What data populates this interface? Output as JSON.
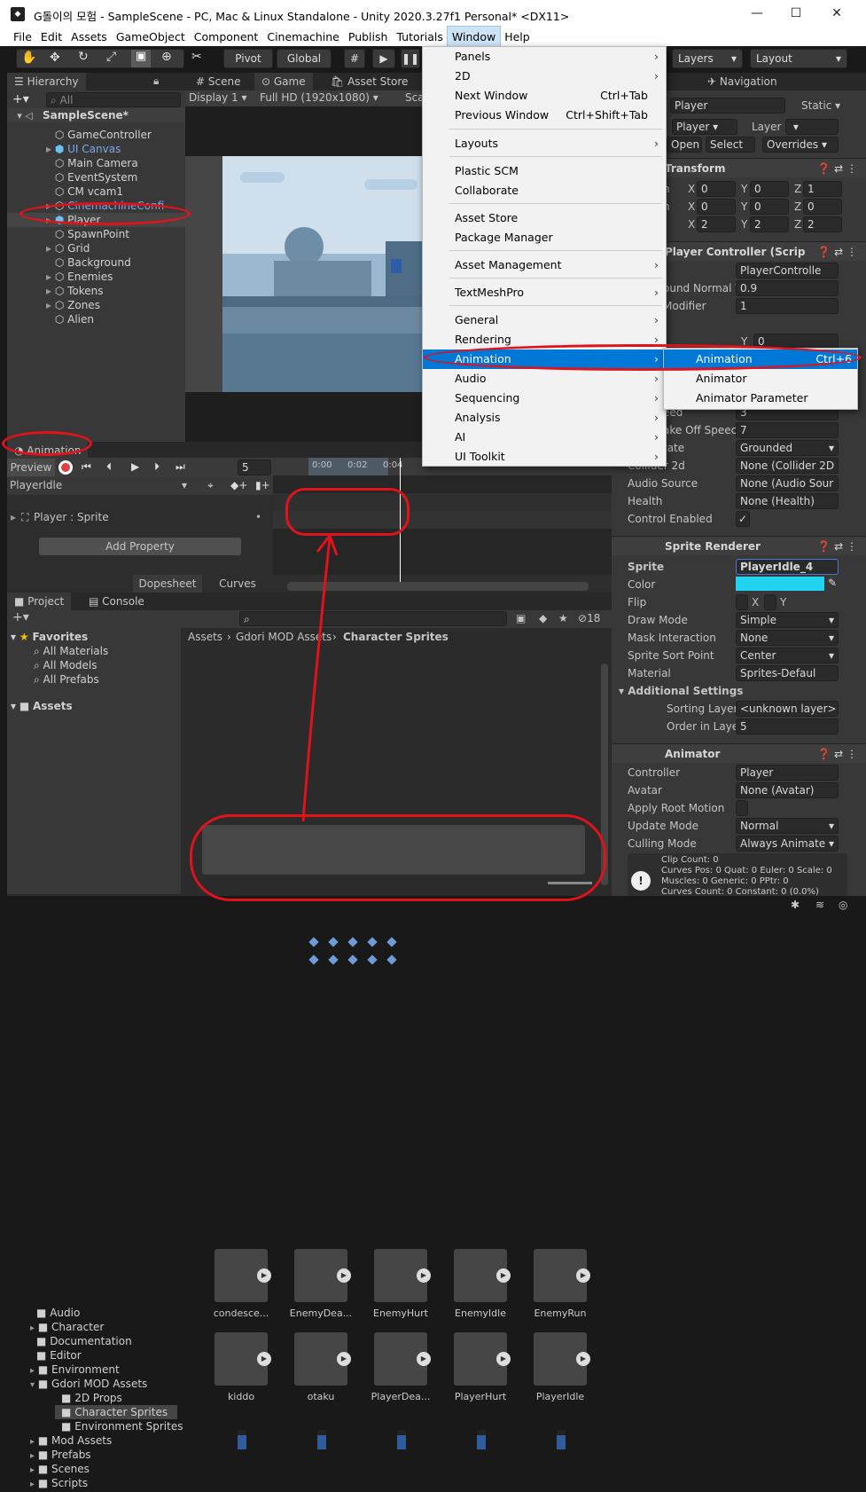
{
  "window": {
    "title": "G돌이의 모험 - SampleScene - PC, Mac & Linux Standalone - Unity 2020.3.27f1 Personal* <DX11>",
    "app_icon": "unity-logo-icon",
    "minimize": "—",
    "maximize": "☐",
    "close": "✕"
  },
  "menubar": [
    "File",
    "Edit",
    "Assets",
    "GameObject",
    "Component",
    "Cinemachine",
    "Publish",
    "Tutorials",
    "Window",
    "Help"
  ],
  "toolbar": {
    "pivot": "Pivot",
    "global": "Global",
    "layers": "Layers",
    "layout": "Layout"
  },
  "hierarchy": {
    "tab": "Hierarchy",
    "search_placeholder": "All",
    "scene": "SampleScene*",
    "items": [
      "GameController",
      "UI Canvas",
      "Main Camera",
      "EventSystem",
      "CM vcam1",
      "CinemachineConfi",
      "Player",
      "SpawnPoint",
      "Grid",
      "Background",
      "Enemies",
      "Tokens",
      "Zones",
      "Alien"
    ]
  },
  "game": {
    "tabs": [
      "Scene",
      "Game",
      "Asset Store"
    ],
    "display": "Display 1",
    "resolution": "Full HD (1920x1080)",
    "scale": "Sca"
  },
  "animation": {
    "tab": "Animation",
    "preview": "Preview",
    "frame": "5",
    "clip": "PlayerIdle",
    "property": "Player : Sprite",
    "add_property": "Add Property",
    "dopesheet": "Dopesheet",
    "curves": "Curves",
    "t0": "0:00",
    "t1": "0:02",
    "t2": "0:04"
  },
  "window_menu": {
    "items": [
      {
        "label": "Panels",
        "shortcut": "",
        "arrow": "›"
      },
      {
        "label": "2D",
        "shortcut": "",
        "arrow": "›"
      },
      {
        "label": "Next Window",
        "shortcut": "Ctrl+Tab",
        "arrow": ""
      },
      {
        "label": "Previous Window",
        "shortcut": "Ctrl+Shift+Tab",
        "arrow": ""
      },
      {
        "label": "Layouts",
        "shortcut": "",
        "arrow": "›"
      },
      {
        "label": "Plastic SCM",
        "shortcut": "",
        "arrow": ""
      },
      {
        "label": "Collaborate",
        "shortcut": "",
        "arrow": ""
      },
      {
        "label": "Asset Store",
        "shortcut": "",
        "arrow": ""
      },
      {
        "label": "Package Manager",
        "shortcut": "",
        "arrow": ""
      },
      {
        "label": "Asset Management",
        "shortcut": "",
        "arrow": "›"
      },
      {
        "label": "TextMeshPro",
        "shortcut": "",
        "arrow": "›"
      },
      {
        "label": "General",
        "shortcut": "",
        "arrow": "›"
      },
      {
        "label": "Rendering",
        "shortcut": "",
        "arrow": "›"
      },
      {
        "label": "Animation",
        "shortcut": "",
        "arrow": "›"
      },
      {
        "label": "Audio",
        "shortcut": "",
        "arrow": "›"
      },
      {
        "label": "Sequencing",
        "shortcut": "",
        "arrow": "›"
      },
      {
        "label": "Analysis",
        "shortcut": "",
        "arrow": "›"
      },
      {
        "label": "AI",
        "shortcut": "",
        "arrow": "›"
      },
      {
        "label": "UI Toolkit",
        "shortcut": "",
        "arrow": "›"
      }
    ]
  },
  "submenu": {
    "items": [
      {
        "label": "Animation",
        "shortcut": "Ctrl+6"
      },
      {
        "label": "Animator",
        "shortcut": ""
      },
      {
        "label": "Animator Parameter",
        "shortcut": ""
      }
    ]
  },
  "inspector": {
    "tab": "tor",
    "navigation": "Navigation",
    "name": "Player",
    "static": "Static",
    "tag": "Player",
    "layer": "Layer",
    "open": "Open",
    "select": "Select",
    "overrides": "Overrides",
    "transform": "Transform",
    "pos": {
      "x": "0",
      "y": "0",
      "z": "1"
    },
    "rot": {
      "x": "0",
      "y": "0",
      "z": "0"
    },
    "scale": {
      "x": "2",
      "y": "2",
      "z": "2"
    },
    "lbl_n1": "n",
    "lbl_n2": "n",
    "pc_title": "Player Controller (Scrip",
    "pc_script": "PlayerControlle",
    "ground_normal_label": "ound Normal Y",
    "ground_normal": "0.9",
    "modifier_label": "Modifier",
    "modifier": "1",
    "y_label": "Y",
    "y_val": "0",
    "speed_label": "eed",
    "speed": "3",
    "takeoff_label": "ake Off Speec",
    "takeoff": "7",
    "state_label": "tate",
    "state": "Grounded",
    "collider_label": "Collider 2d",
    "collider": "None (Collider 2D",
    "audio_label": "Audio Source",
    "audio": "None (Audio Sour",
    "health_label": "Health",
    "health": "None (Health)",
    "control_label": "Control Enabled",
    "check": "✓",
    "sr_title": "Sprite Renderer",
    "sprite_label": "Sprite",
    "sprite": "PlayerIdle_4",
    "color_label": "Color",
    "color": "#22d3f0",
    "flip_label": "Flip",
    "flip_x": "X",
    "flip_y": "Y",
    "draw_label": "Draw Mode",
    "draw": "Simple",
    "mask_label": "Mask Interaction",
    "mask": "None",
    "sort_label": "Sprite Sort Point",
    "sort": "Center",
    "material_label": "Material",
    "material": "Sprites-Defaul",
    "additional": "Additional Settings",
    "sorting_layer_label": "Sorting Layer",
    "sorting_layer": "<unknown layer>",
    "order_label": "Order in Layer",
    "order": "5",
    "anim_title": "Animator",
    "controller_label": "Controller",
    "controller": "Player",
    "avatar_label": "Avatar",
    "avatar": "None (Avatar)",
    "root_label": "Apply Root Motion",
    "update_label": "Update Mode",
    "update": "Normal",
    "culling_label": "Culling Mode",
    "culling": "Always Animate",
    "info": [
      "Clip Count: 0",
      "Curves Pos: 0 Quat: 0 Euler: 0 Scale: 0",
      "Muscles: 0 Generic: 0 PPtr: 0",
      "Curves Count: 0 Constant: 0 (0.0%)"
    ]
  },
  "project": {
    "tab": "Project",
    "console": "Console",
    "count": "18",
    "breadcrumb": [
      "Assets",
      "Gdori MOD Assets",
      "Character Sprites"
    ],
    "favorites": "Favorites",
    "fav_items": [
      "All Materials",
      "All Models",
      "All Prefabs"
    ],
    "assets": "Assets",
    "tree": [
      "Audio",
      "Character",
      "Documentation",
      "Editor",
      "Environment",
      "Gdori MOD Assets",
      "2D Props",
      "Character Sprites",
      "Environment Sprites",
      "Mod Assets",
      "Prefabs",
      "Scenes",
      "Scripts"
    ],
    "grid": [
      "condesce...",
      "EnemyDea...",
      "EnemyHurt",
      "EnemyIdle",
      "EnemyRun",
      "kiddo",
      "otaku",
      "PlayerDea...",
      "PlayerHurt",
      "PlayerIdle"
    ]
  }
}
